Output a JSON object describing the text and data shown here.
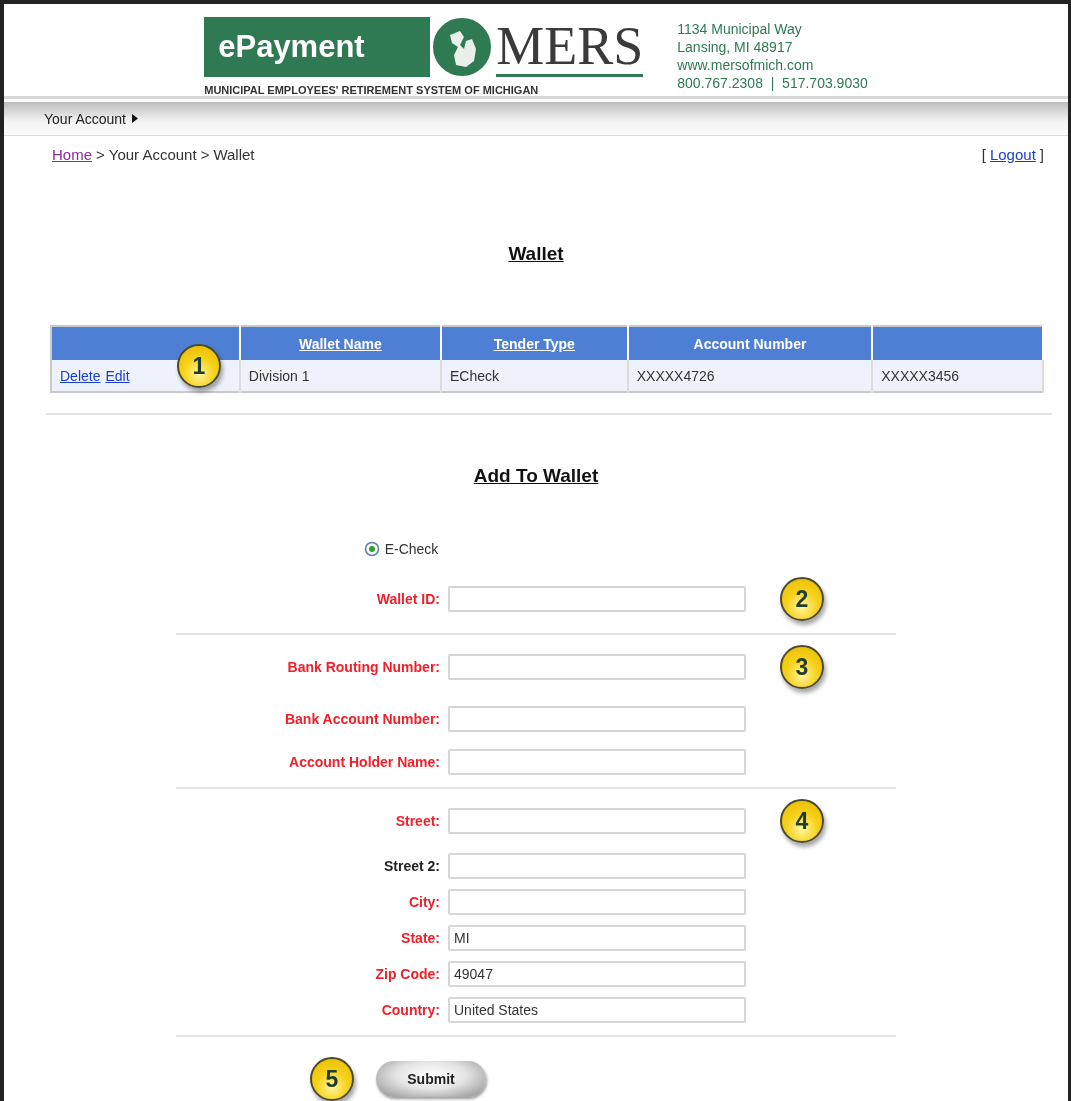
{
  "header": {
    "wordmark": "ePayment",
    "brand": "MERS",
    "tagline": "MUNICIPAL EMPLOYEES' RETIREMENT SYSTEM OF MICHIGAN",
    "contact": [
      "1134 Municipal Way",
      "Lansing, MI 48917",
      "www.mersofmich.com",
      "800.767.2308  |  517.703.9030"
    ]
  },
  "nav": [
    {
      "label": "Your Account"
    }
  ],
  "breadcrumb": {
    "separator": ">",
    "items": [
      {
        "label": "Home",
        "kind": "link"
      },
      {
        "label": "Your Account",
        "kind": "text"
      },
      {
        "label": "Wallet",
        "kind": "text"
      }
    ]
  },
  "logout": {
    "open": "[",
    "label": "Logout",
    "close": "]"
  },
  "wallet": {
    "title": "Wallet",
    "callout": "1",
    "columns": [
      {
        "kind": "sort",
        "label": "Wallet Name"
      },
      {
        "kind": "sort",
        "label": "Tender Type"
      },
      {
        "kind": "plain",
        "label": "Account Number"
      },
      {
        "kind": "blank"
      }
    ],
    "rows": [
      {
        "actions": [
          "Delete",
          "Edit"
        ],
        "cells": [
          "Division 1",
          "ECheck",
          "XXXXX4726",
          "XXXXX3456"
        ]
      }
    ]
  },
  "add": {
    "title": "Add To Wallet",
    "payment_types": [
      {
        "label": "E-Check",
        "selected": true
      }
    ],
    "sections": [
      {
        "callout": "2",
        "fields": [
          {
            "label": "Wallet ID:",
            "required": true
          }
        ]
      },
      {
        "callout": "3",
        "fields": [
          {
            "label": "Bank Routing Number:",
            "required": true
          },
          {
            "label": "Bank Account Number:",
            "required": true
          },
          {
            "label": "Account Holder Name:",
            "required": true
          }
        ]
      },
      {
        "callout": "4",
        "fields": [
          {
            "label": "Street:",
            "required": true
          },
          {
            "label": "Street 2:",
            "required": false
          },
          {
            "label": "City:",
            "required": true
          },
          {
            "label": "State:",
            "required": true,
            "value": "MI"
          },
          {
            "label": "Zip Code:",
            "required": true,
            "value": "49047"
          },
          {
            "label": "Country:",
            "required": true,
            "value": "United States"
          }
        ]
      }
    ],
    "submit": {
      "label": "Submit",
      "callout": "5"
    }
  }
}
